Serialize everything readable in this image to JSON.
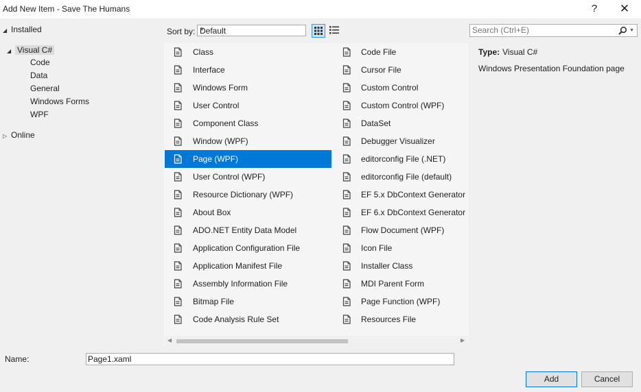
{
  "window": {
    "title": "Add New Item - Save The Humans",
    "help_label": "?",
    "close_label": "✕"
  },
  "tree": {
    "installed": "Installed",
    "visual_csharp": "Visual C#",
    "children": [
      "Code",
      "Data",
      "General",
      "Windows Forms",
      "WPF"
    ],
    "online": "Online"
  },
  "toolbar": {
    "sort_by_label": "Sort by:",
    "sort_value": "Default"
  },
  "search": {
    "placeholder": "Search (Ctrl+E)"
  },
  "items": {
    "left": [
      "Class",
      "Interface",
      "Windows Form",
      "User Control",
      "Component Class",
      "Window (WPF)",
      "Page (WPF)",
      "User Control (WPF)",
      "Resource Dictionary (WPF)",
      "About Box",
      "ADO.NET Entity Data Model",
      "Application Configuration File",
      "Application Manifest File",
      "Assembly Information File",
      "Bitmap File",
      "Code Analysis Rule Set"
    ],
    "right": [
      "Code File",
      "Cursor File",
      "Custom Control",
      "Custom Control (WPF)",
      "DataSet",
      "Debugger Visualizer",
      "editorconfig File (.NET)",
      "editorconfig File (default)",
      "EF 5.x DbContext Generator",
      "EF 6.x DbContext Generator",
      "Flow Document (WPF)",
      "Icon File",
      "Installer Class",
      "MDI Parent Form",
      "Page Function (WPF)",
      "Resources File"
    ],
    "selected_label": "Page (WPF)"
  },
  "info": {
    "type_label": "Type:",
    "type_value": "Visual C#",
    "description": "Windows Presentation Foundation page"
  },
  "name": {
    "label": "Name:",
    "value": "Page1.xaml"
  },
  "buttons": {
    "add": "Add",
    "cancel": "Cancel"
  },
  "colors": {
    "selection": "#0078d7",
    "accent_border": "#0078d7"
  }
}
